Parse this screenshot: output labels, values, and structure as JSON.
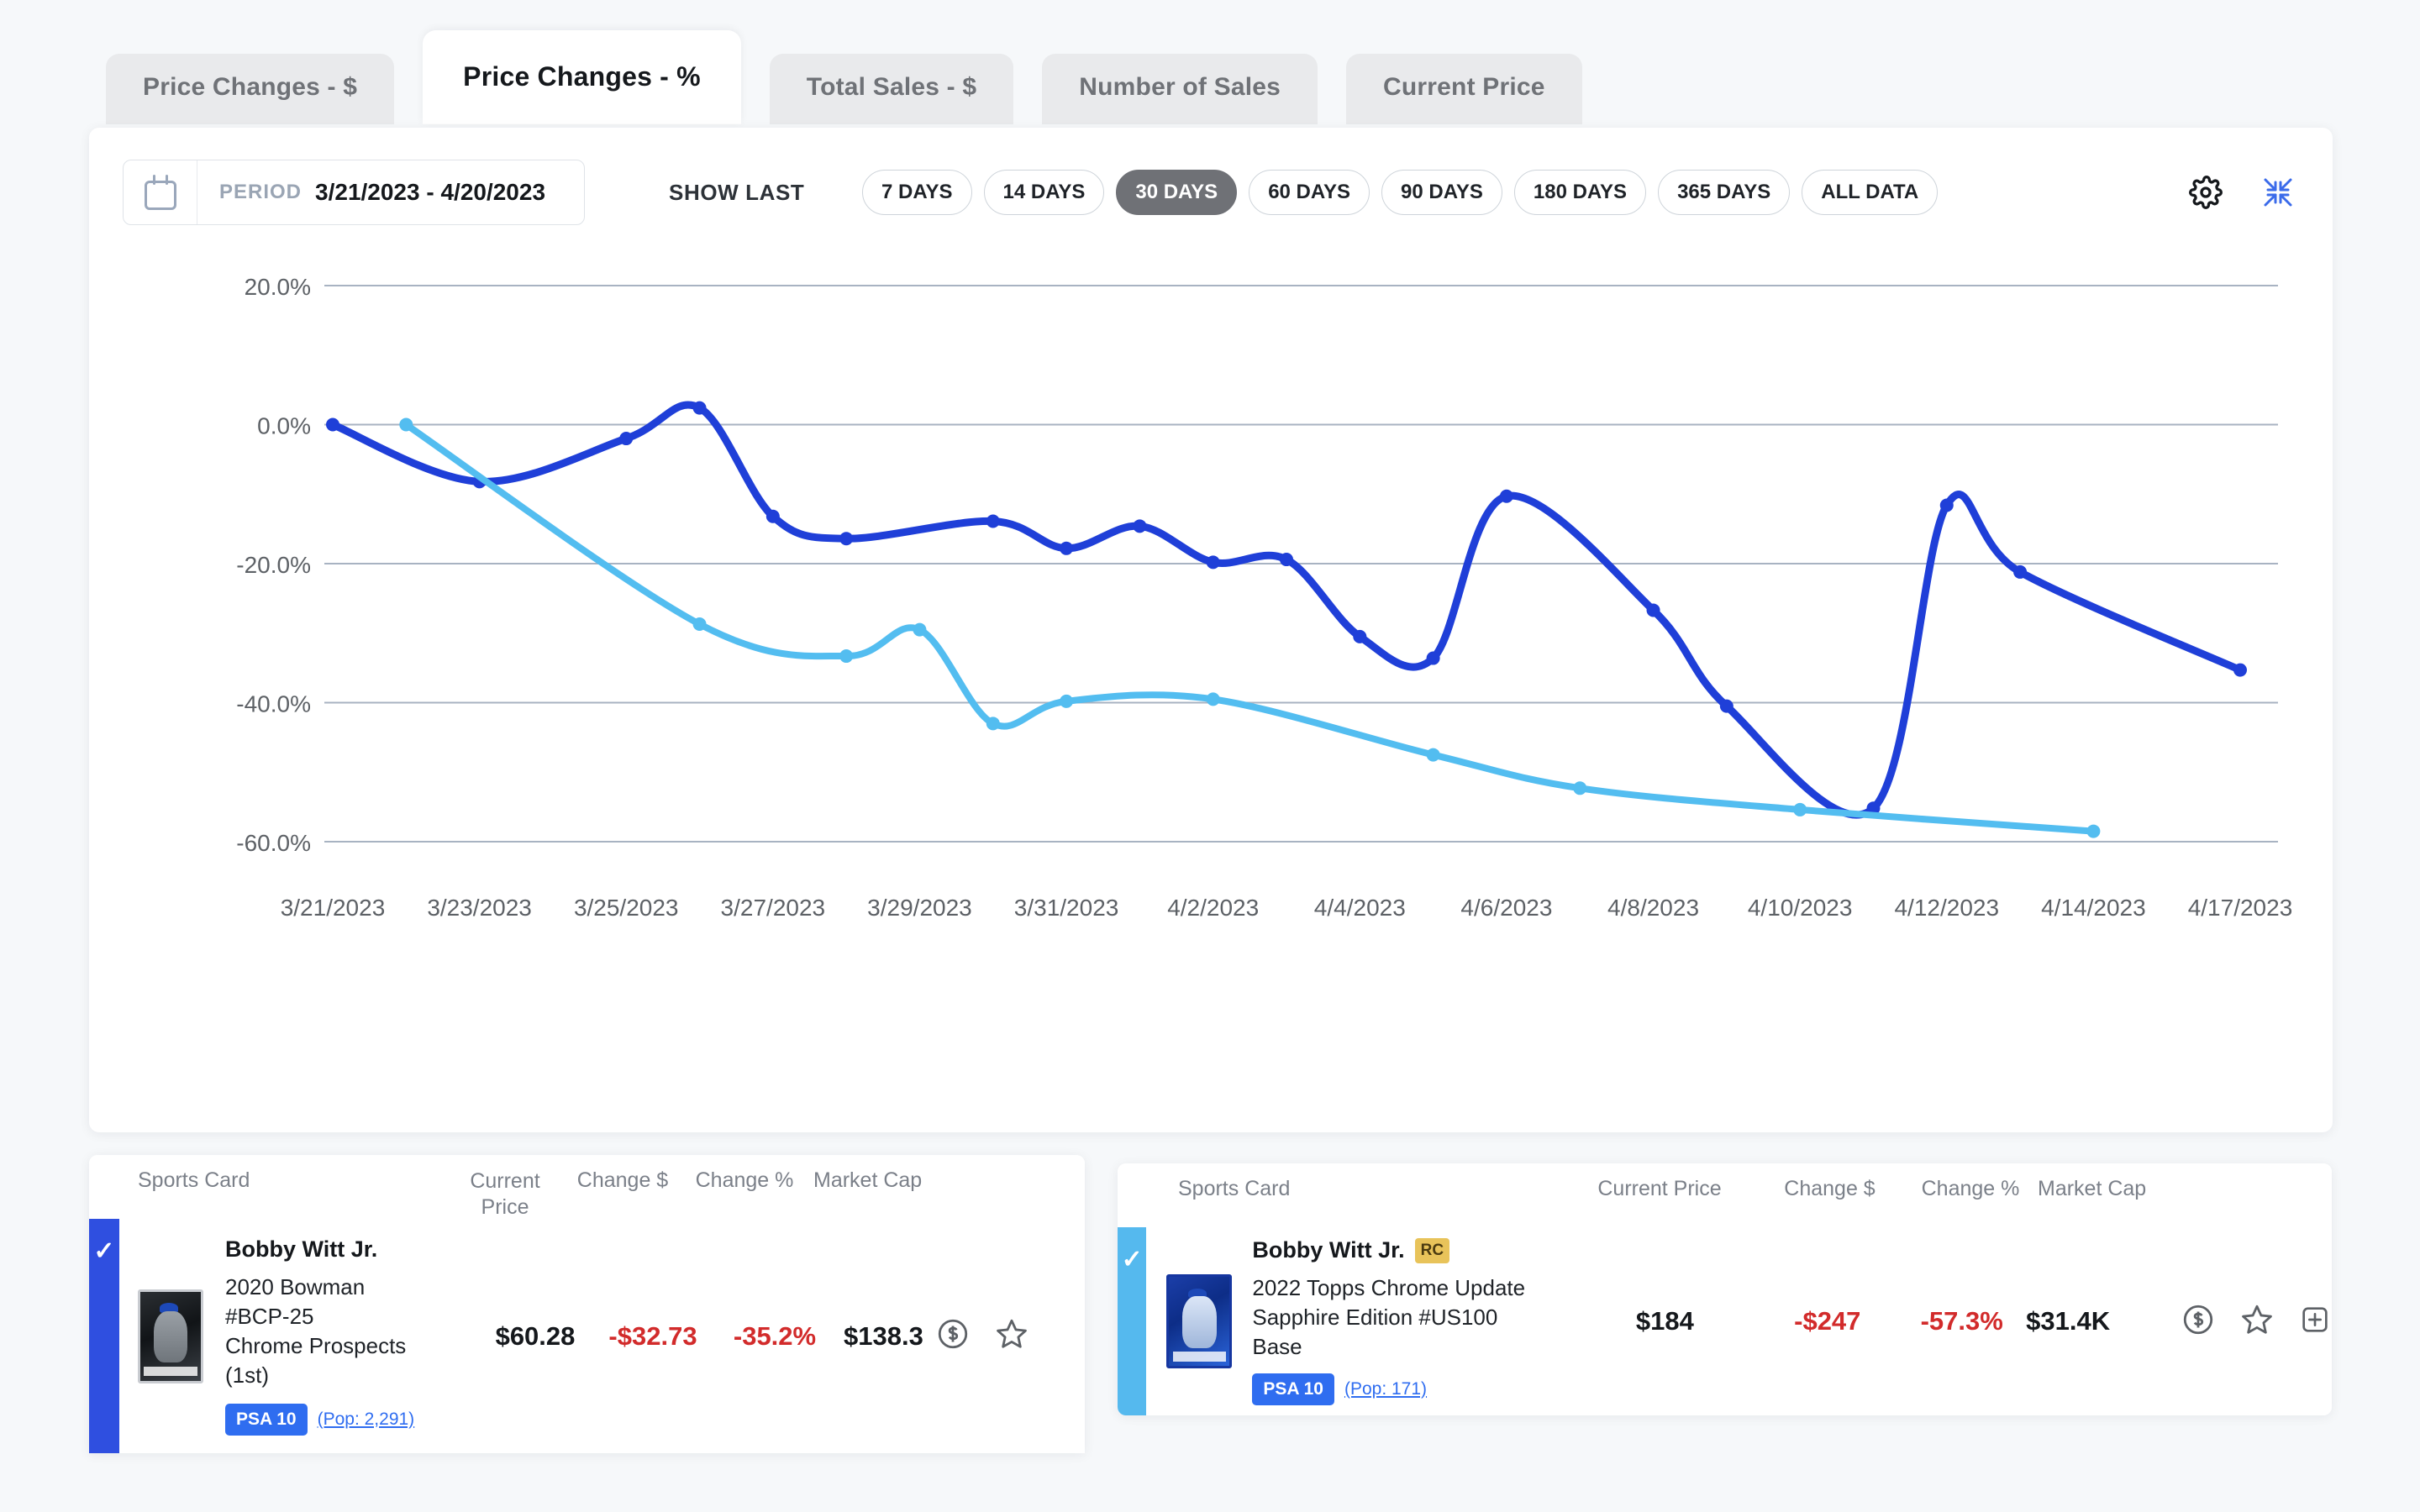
{
  "tabs": [
    {
      "label": "Price Changes - $",
      "active": false
    },
    {
      "label": "Price Changes - %",
      "active": true
    },
    {
      "label": "Total Sales - $",
      "active": false
    },
    {
      "label": "Number of Sales",
      "active": false
    },
    {
      "label": "Current Price",
      "active": false
    }
  ],
  "toolbar": {
    "calendar_icon": "calendar-icon",
    "period_label": "PERIOD",
    "period_value": "3/21/2023 - 4/20/2023",
    "show_last_label": "SHOW LAST",
    "range_pills": [
      {
        "label": "7 DAYS",
        "active": false
      },
      {
        "label": "14 DAYS",
        "active": false
      },
      {
        "label": "30 DAYS",
        "active": true
      },
      {
        "label": "60 DAYS",
        "active": false
      },
      {
        "label": "90 DAYS",
        "active": false
      },
      {
        "label": "180 DAYS",
        "active": false
      },
      {
        "label": "365 DAYS",
        "active": false
      },
      {
        "label": "ALL DATA",
        "active": false
      }
    ],
    "settings_icon": "gear-icon",
    "collapse_icon": "collapse-arrows-icon"
  },
  "chart_data": {
    "type": "line",
    "title": "",
    "xlabel": "",
    "ylabel": "",
    "ylim": [
      -60,
      20
    ],
    "yticks": [
      20,
      0,
      -20,
      -40,
      -60
    ],
    "ytick_labels": [
      "20.0%",
      "0.0%",
      "-20.0%",
      "-40.0%",
      "-60.0%"
    ],
    "grid": true,
    "legend": "none",
    "xtick_labels": [
      "3/21/2023",
      "3/23/2023",
      "3/25/2023",
      "3/27/2023",
      "3/29/2023",
      "3/31/2023",
      "4/2/2023",
      "4/4/2023",
      "4/6/2023",
      "4/8/2023",
      "4/10/2023",
      "4/12/2023",
      "4/14/2023",
      "4/17/2023"
    ],
    "x": [
      "3/21/2023",
      "3/22/2023",
      "3/23/2023",
      "3/24/2023",
      "3/25/2023",
      "3/26/2023",
      "3/27/2023",
      "3/28/2023",
      "3/29/2023",
      "3/30/2023",
      "3/31/2023",
      "4/1/2023",
      "4/2/2023",
      "4/3/2023",
      "4/4/2023",
      "4/5/2023",
      "4/6/2023",
      "4/7/2023",
      "4/8/2023",
      "4/9/2023",
      "4/10/2023",
      "4/11/2023",
      "4/12/2023",
      "4/13/2023",
      "4/14/2023",
      "4/15/2023",
      "4/17/2023"
    ],
    "series": [
      {
        "name": "2020 Bowman Chrome Prospects #BCP-25 PSA 10",
        "color": "#1f3fd8",
        "points": [
          {
            "x": "3/21/2023",
            "y": 0.0
          },
          {
            "x": "3/23/2023",
            "y": -8.2
          },
          {
            "x": "3/25/2023",
            "y": -2.0
          },
          {
            "x": "3/26/2023",
            "y": 2.4
          },
          {
            "x": "3/27/2023",
            "y": -13.2
          },
          {
            "x": "3/28/2023",
            "y": -16.4
          },
          {
            "x": "3/30/2023",
            "y": -13.9
          },
          {
            "x": "3/31/2023",
            "y": -17.8
          },
          {
            "x": "4/1/2023",
            "y": -14.6
          },
          {
            "x": "4/2/2023",
            "y": -19.8
          },
          {
            "x": "4/3/2023",
            "y": -19.4
          },
          {
            "x": "4/4/2023",
            "y": -30.5
          },
          {
            "x": "4/5/2023",
            "y": -33.6
          },
          {
            "x": "4/6/2023",
            "y": -10.3
          },
          {
            "x": "4/8/2023",
            "y": -26.7
          },
          {
            "x": "4/9/2023",
            "y": -40.5
          },
          {
            "x": "4/11/2023",
            "y": -55.2
          },
          {
            "x": "4/12/2023",
            "y": -11.6
          },
          {
            "x": "4/13/2023",
            "y": -21.2
          },
          {
            "x": "4/17/2023",
            "y": -35.3
          }
        ]
      },
      {
        "name": "2022 Topps Chrome Update Sapphire Edition #US100 PSA 10",
        "color": "#53bdf0",
        "points": [
          {
            "x": "3/22/2023",
            "y": 0.0
          },
          {
            "x": "3/26/2023",
            "y": -28.7
          },
          {
            "x": "3/28/2023",
            "y": -33.3
          },
          {
            "x": "3/29/2023",
            "y": -29.5
          },
          {
            "x": "3/30/2023",
            "y": -43.0
          },
          {
            "x": "3/31/2023",
            "y": -39.8
          },
          {
            "x": "4/2/2023",
            "y": -39.5
          },
          {
            "x": "4/5/2023",
            "y": -47.5
          },
          {
            "x": "4/7/2023",
            "y": -52.3
          },
          {
            "x": "4/10/2023",
            "y": -55.4
          },
          {
            "x": "4/14/2023",
            "y": -58.5
          }
        ]
      }
    ]
  },
  "table_left": {
    "columns": [
      "Sports Card",
      "Current Price",
      "Change $",
      "Change %",
      "Market Cap"
    ],
    "rows": [
      {
        "selected": true,
        "check_icon": "check-icon",
        "thumbnail": "baseball-card-thumbnail",
        "player": "Bobby Witt Jr.",
        "detail_lines": [
          "2020 Bowman",
          "#BCP-25",
          "Chrome Prospects",
          "(1st)"
        ],
        "grade": "PSA 10",
        "pop": "(Pop: 2,291)",
        "current_price": "$60.28",
        "change_dollar": "-$32.73",
        "change_percent": "-35.2%",
        "market_cap": "$138.3",
        "dollar_icon": "dollar-circle-icon",
        "star_icon": "star-icon"
      }
    ]
  },
  "table_right": {
    "columns": [
      "Sports Card",
      "Current Price",
      "Change $",
      "Change %",
      "Market Cap"
    ],
    "rows": [
      {
        "selected": true,
        "check_icon": "check-icon",
        "thumbnail": "baseball-card-thumbnail",
        "player": "Bobby Witt Jr.",
        "rookie_badge": "RC",
        "detail_lines": [
          "2022 Topps Chrome Update",
          "Sapphire Edition #US100",
          "Base"
        ],
        "grade": "PSA 10",
        "pop": "(Pop: 171)",
        "current_price": "$184",
        "change_dollar": "-$247",
        "change_percent": "-57.3%",
        "market_cap": "$31.4K",
        "dollar_icon": "dollar-circle-icon",
        "star_icon": "star-icon",
        "add_icon": "plus-square-icon"
      }
    ]
  },
  "colors": {
    "series_dark": "#1f3fd8",
    "series_light": "#53bdf0",
    "negative": "#d22b2b",
    "accent": "#2f6df0"
  }
}
